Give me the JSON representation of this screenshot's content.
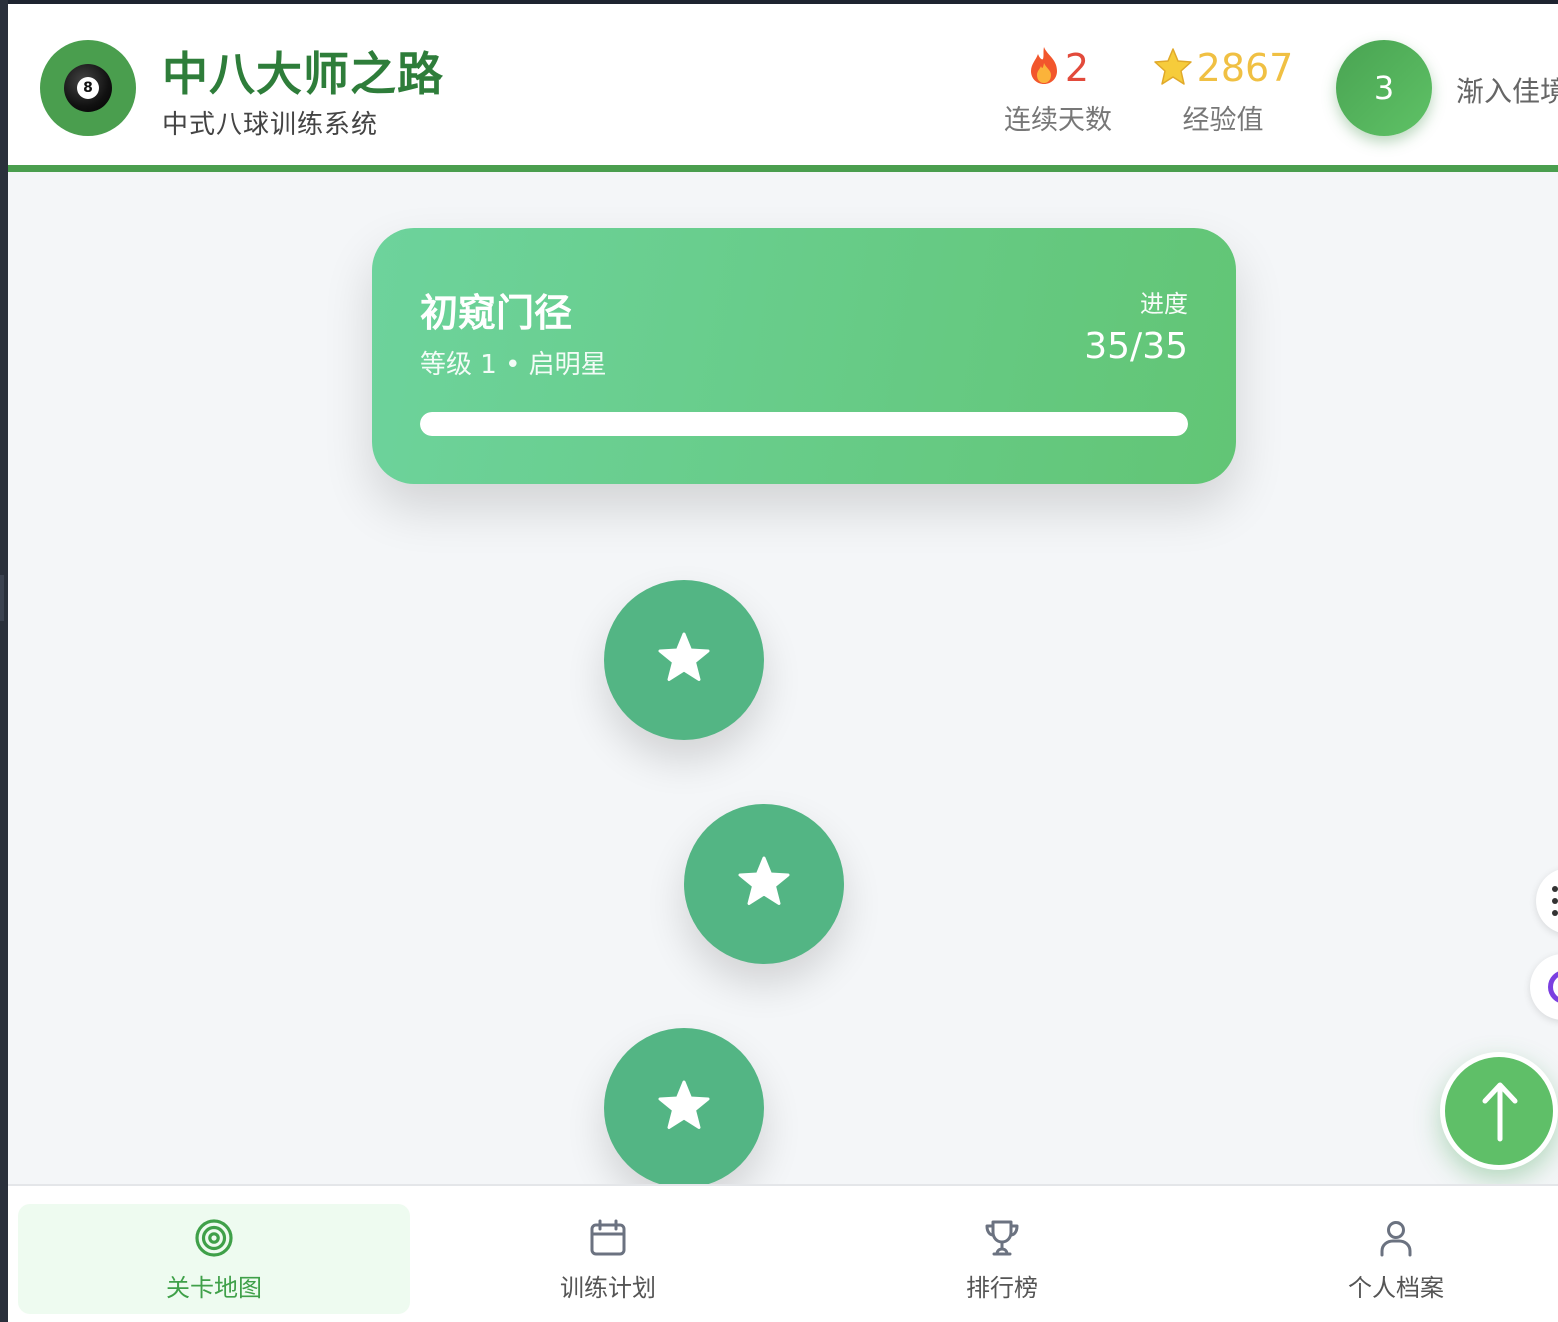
{
  "header": {
    "logo_ball_number": "8",
    "title": "中八大师之路",
    "subtitle": "中式八球训练系统",
    "streak": {
      "icon": "fire-icon",
      "value": "2",
      "label": "连续天数"
    },
    "xp": {
      "icon": "star-icon",
      "value": "2867",
      "label": "经验值"
    },
    "level": {
      "number": "3",
      "name": "渐入佳境"
    }
  },
  "level_card": {
    "title": "初窥门径",
    "subtitle": "等级 1 • 启明星",
    "progress_label": "进度",
    "progress_text": "35/35",
    "progress_fraction": 1.0
  },
  "nodes": [
    {
      "icon": "star-icon",
      "state": "completed"
    },
    {
      "icon": "star-icon",
      "state": "completed"
    },
    {
      "icon": "star-icon",
      "state": "completed"
    }
  ],
  "bottom_nav": {
    "items": [
      {
        "label": "关卡地图",
        "icon": "target-icon",
        "active": true
      },
      {
        "label": "训练计划",
        "icon": "calendar-icon",
        "active": false
      },
      {
        "label": "排行榜",
        "icon": "trophy-icon",
        "active": false
      },
      {
        "label": "个人档案",
        "icon": "user-icon",
        "active": false
      }
    ]
  },
  "colors": {
    "brand_green": "#4a9e4e",
    "card_gradient_start": "#6dd39c",
    "card_gradient_end": "#62c575",
    "node_green": "#53b584",
    "streak_red": "#e24a3b",
    "xp_gold": "#f0c043"
  }
}
